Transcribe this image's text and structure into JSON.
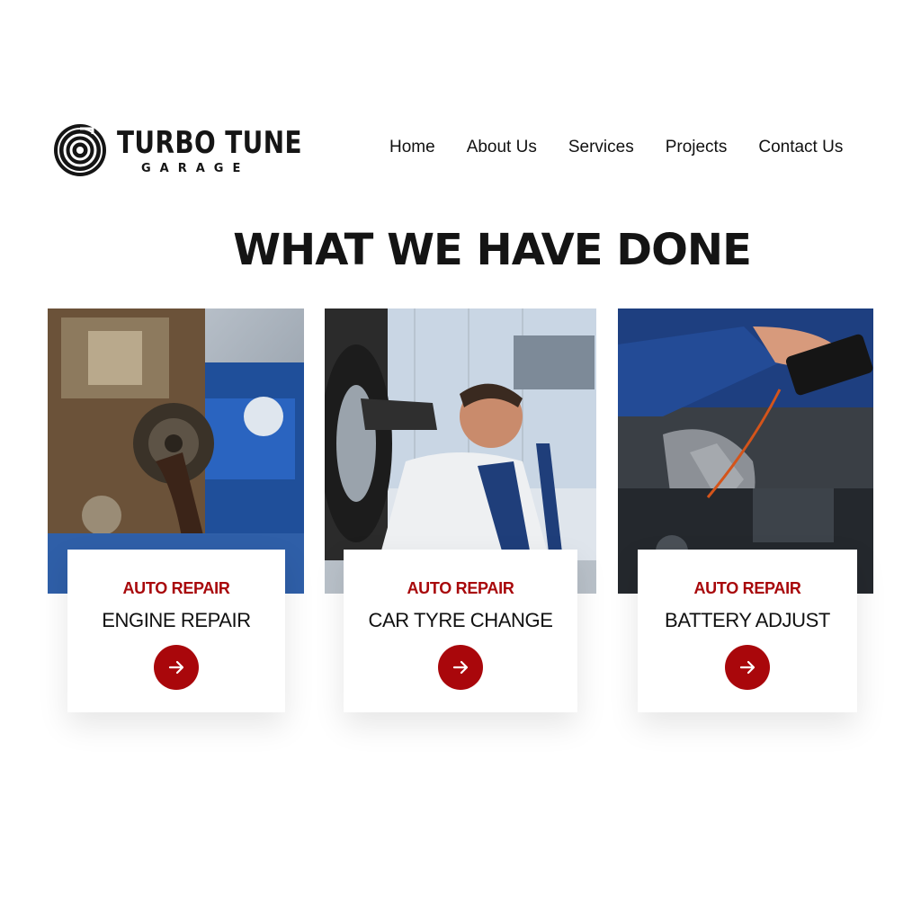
{
  "brand": {
    "name": "TURBO TUNE",
    "sub": "GARAGE"
  },
  "nav": [
    "Home",
    "About Us",
    "Services",
    "Projects",
    "Contact Us"
  ],
  "section": {
    "title": "WHAT WE HAVE DONE"
  },
  "cards": [
    {
      "category": "AUTO REPAIR",
      "title": "ENGINE REPAIR",
      "image": "engine-repair-photo",
      "icon": "arrow-right-icon"
    },
    {
      "category": "AUTO REPAIR",
      "title": "CAR TYRE CHANGE",
      "image": "tyre-change-photo",
      "icon": "arrow-right-icon"
    },
    {
      "category": "AUTO REPAIR",
      "title": "BATTERY ADJUST",
      "image": "battery-adjust-photo",
      "icon": "arrow-right-icon"
    }
  ],
  "colors": {
    "accent": "#a9070b",
    "text": "#111111",
    "background": "#ffffff"
  }
}
